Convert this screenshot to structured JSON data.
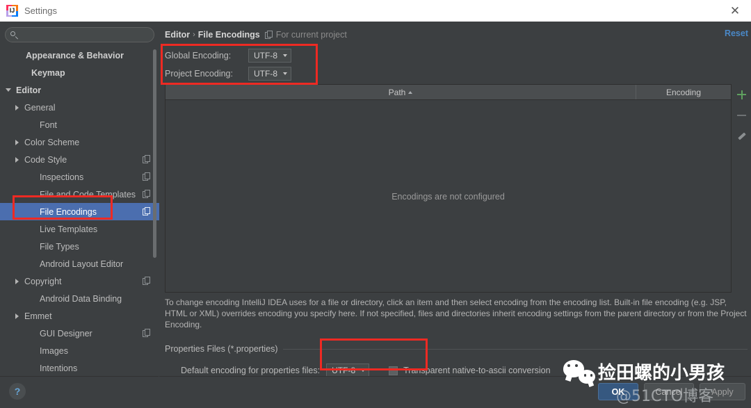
{
  "window": {
    "title": "Settings",
    "app_icon": "intellij-idea-icon",
    "close_label": "✕"
  },
  "sidebar": {
    "search": {
      "value": "",
      "placeholder": "",
      "icon": "search-icon"
    },
    "items": [
      {
        "label": "Appearance & Behavior",
        "arrow": "none",
        "bold": true,
        "indent": 22,
        "copy": false,
        "selected": false
      },
      {
        "label": "Keymap",
        "arrow": "none",
        "bold": true,
        "indent": 30,
        "copy": false,
        "selected": false
      },
      {
        "label": "Editor",
        "arrow": "down",
        "bold": true,
        "indent": 8,
        "copy": false,
        "selected": false
      },
      {
        "label": "General",
        "arrow": "right",
        "bold": false,
        "indent": 20,
        "copy": false,
        "selected": false
      },
      {
        "label": "Font",
        "arrow": "none",
        "bold": false,
        "indent": 42,
        "copy": false,
        "selected": false
      },
      {
        "label": "Color Scheme",
        "arrow": "right",
        "bold": false,
        "indent": 20,
        "copy": false,
        "selected": false
      },
      {
        "label": "Code Style",
        "arrow": "right",
        "bold": false,
        "indent": 20,
        "copy": true,
        "selected": false
      },
      {
        "label": "Inspections",
        "arrow": "none",
        "bold": false,
        "indent": 42,
        "copy": true,
        "selected": false
      },
      {
        "label": "File and Code Templates",
        "arrow": "none",
        "bold": false,
        "indent": 42,
        "copy": true,
        "selected": false
      },
      {
        "label": "File Encodings",
        "arrow": "none",
        "bold": false,
        "indent": 42,
        "copy": true,
        "selected": true
      },
      {
        "label": "Live Templates",
        "arrow": "none",
        "bold": false,
        "indent": 42,
        "copy": false,
        "selected": false
      },
      {
        "label": "File Types",
        "arrow": "none",
        "bold": false,
        "indent": 42,
        "copy": false,
        "selected": false
      },
      {
        "label": "Android Layout Editor",
        "arrow": "none",
        "bold": false,
        "indent": 42,
        "copy": false,
        "selected": false
      },
      {
        "label": "Copyright",
        "arrow": "right",
        "bold": false,
        "indent": 20,
        "copy": true,
        "selected": false
      },
      {
        "label": "Android Data Binding",
        "arrow": "none",
        "bold": false,
        "indent": 42,
        "copy": false,
        "selected": false
      },
      {
        "label": "Emmet",
        "arrow": "right",
        "bold": false,
        "indent": 20,
        "copy": false,
        "selected": false
      },
      {
        "label": "GUI Designer",
        "arrow": "none",
        "bold": false,
        "indent": 42,
        "copy": true,
        "selected": false
      },
      {
        "label": "Images",
        "arrow": "none",
        "bold": false,
        "indent": 42,
        "copy": false,
        "selected": false
      },
      {
        "label": "Intentions",
        "arrow": "none",
        "bold": false,
        "indent": 42,
        "copy": false,
        "selected": false
      }
    ],
    "help_label": "?"
  },
  "main": {
    "breadcrumb": {
      "root": "Editor",
      "separator": "›",
      "current": "File Encodings",
      "scope_icon": "project-scope-icon",
      "scope_text": "For current project"
    },
    "reset_label": "Reset",
    "encodings": [
      {
        "label": "Global Encoding:",
        "value": "UTF-8"
      },
      {
        "label": "Project Encoding:",
        "value": "UTF-8"
      }
    ],
    "table": {
      "columns": [
        "Path",
        "Encoding"
      ],
      "sort_column": "Path",
      "sort_direction": "asc",
      "empty_message": "Encodings are not configured",
      "rows": []
    },
    "tools": [
      {
        "name": "add-encoding-button",
        "glyph": "plus-icon",
        "color": "#5fa05f"
      },
      {
        "name": "remove-encoding-button",
        "glyph": "minus-icon",
        "color": "#6e7274"
      },
      {
        "name": "edit-encoding-button",
        "glyph": "pencil-icon",
        "color": "#8b8f91"
      }
    ],
    "description": "To change encoding IntelliJ IDEA uses for a file or directory, click an item and then select encoding from the encoding list. Built-in file encoding (e.g. JSP, HTML or XML) overrides encoding you specify here. If not specified, files and directories inherit encoding settings from the parent directory or from the Project Encoding.",
    "properties_group": {
      "title": "Properties Files (*.properties)",
      "default_encoding_label": "Default encoding for properties files:",
      "default_encoding_value": "UTF-8",
      "transparent_label": "Transparent native-to-ascii conversion",
      "transparent_checked": false
    }
  },
  "footer": {
    "ok": "OK",
    "cancel": "Cancel",
    "apply": "Apply"
  },
  "watermarks": {
    "wechat_text": "捡田螺的小男孩",
    "cto_text": "@51CTO博客"
  },
  "colors": {
    "background": "#3c3f41",
    "selection": "#4b6eaf",
    "accent_link": "#4a88c7",
    "annotation_red": "#ee2a23",
    "ok_button": "#365880"
  }
}
